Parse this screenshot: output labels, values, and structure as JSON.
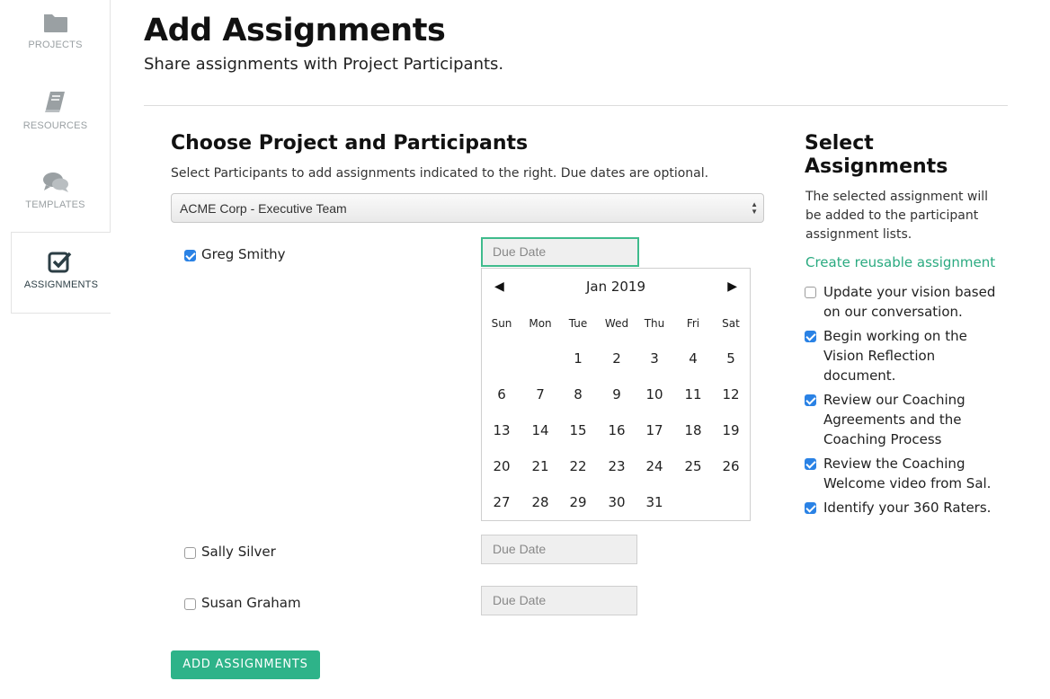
{
  "sidebar": {
    "items": [
      {
        "label": "PROJECTS",
        "icon": "folder-icon"
      },
      {
        "label": "RESOURCES",
        "icon": "book-icon"
      },
      {
        "label": "TEMPLATES",
        "icon": "chat-bubbles-icon"
      },
      {
        "label": "ASSIGNMENTS",
        "icon": "checkbox-icon",
        "active": true
      }
    ]
  },
  "header": {
    "title": "Add Assignments",
    "subtitle": "Share assignments with Project Participants."
  },
  "participants_section": {
    "heading": "Choose Project and Participants",
    "description": "Select Participants to add assignments indicated to the right. Due dates are optional.",
    "project_select": "ACME Corp - Executive Team",
    "participants": [
      {
        "name": "Greg Smithy",
        "checked": true,
        "due_placeholder": "Due Date"
      },
      {
        "name": "Sally Silver",
        "checked": false,
        "due_placeholder": "Due Date"
      },
      {
        "name": "Susan Graham",
        "checked": false,
        "due_placeholder": "Due Date"
      }
    ]
  },
  "calendar": {
    "month_label": "Jan 2019",
    "prev": "◀",
    "next": "▶",
    "weekdays": [
      "Sun",
      "Mon",
      "Tue",
      "Wed",
      "Thu",
      "Fri",
      "Sat"
    ],
    "first_weekday_index": 2,
    "days": [
      "1",
      "2",
      "3",
      "4",
      "5",
      "6",
      "7",
      "8",
      "9",
      "10",
      "11",
      "12",
      "13",
      "14",
      "15",
      "16",
      "17",
      "18",
      "19",
      "20",
      "21",
      "22",
      "23",
      "24",
      "25",
      "26",
      "27",
      "28",
      "29",
      "30",
      "31"
    ]
  },
  "assignments_section": {
    "heading_line1": "Select",
    "heading_line2": "Assignments",
    "description": "The selected assignment will be added to the participant assignment lists.",
    "create_link": "Create reusable assignment",
    "items": [
      {
        "label": "Update your vision based on our conversation.",
        "checked": false
      },
      {
        "label": "Begin working on the Vision Reflection document.",
        "checked": true
      },
      {
        "label": "Review our Coaching Agreements and the Coaching Process",
        "checked": true
      },
      {
        "label": "Review the Coaching Welcome video from Sal.",
        "checked": true
      },
      {
        "label": "Identify your 360 Raters.",
        "checked": true
      }
    ]
  },
  "actions": {
    "add_label": "ADD ASSIGNMENTS"
  },
  "colors": {
    "accent": "#2eb389",
    "link": "#2aaa80",
    "checkbox": "#2a82e5",
    "sidebar_text": "#9aa0a3"
  }
}
